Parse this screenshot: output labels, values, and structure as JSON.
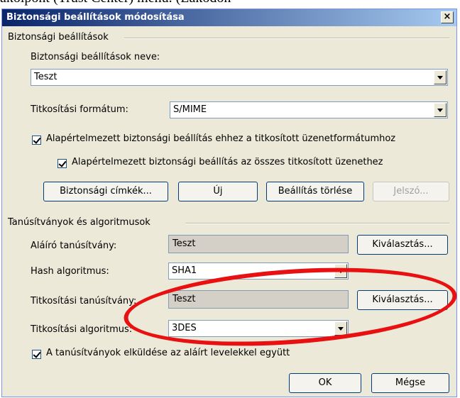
{
  "background_text": "akolpont (Trust Center) menu. (Lakodon",
  "dialog": {
    "title": "Biztonsági beállítások módosítása",
    "close_glyph": "×",
    "group1": {
      "label": "Biztonsági beállítások",
      "name_label": "Biztonsági beállítások neve:",
      "name_value": "Teszt",
      "format_label": "Titkosítási formátum:",
      "format_value": "S/MIME",
      "checkbox1": {
        "label": "Alapértelmezett biztonsági beállítás ehhez a titkosított üzenetformátumhoz",
        "checked": true
      },
      "checkbox2": {
        "label": "Alapértelmezett biztonsági beállítás az összes titkosított üzenethez",
        "checked": true
      },
      "buttons": {
        "labels": "Biztonsági címkék...",
        "new": "Új",
        "delete": "Beállítás törlése",
        "password": "Jelszó..."
      }
    },
    "group2": {
      "label": "Tanúsítványok és algoritmusok",
      "signing_cert_label": "Aláíró tanúsítvány:",
      "signing_cert_value": "Teszt",
      "choose1": "Kiválasztás...",
      "hash_label": "Hash algoritmus:",
      "hash_value": "SHA1",
      "enc_cert_label": "Titkosítási tanúsítvány:",
      "enc_cert_value": "Teszt",
      "choose2": "Kiválasztás...",
      "enc_alg_label": "Titkosítási algoritmus:",
      "enc_alg_value": "3DES",
      "send_certs": {
        "label": "A tanúsítványok elküldése az aláírt levelekkel együtt",
        "checked": true
      }
    },
    "ok": "OK",
    "cancel": "Mégse"
  },
  "colors": {
    "title_start": "#0a246a",
    "annotation": "#e81010"
  }
}
